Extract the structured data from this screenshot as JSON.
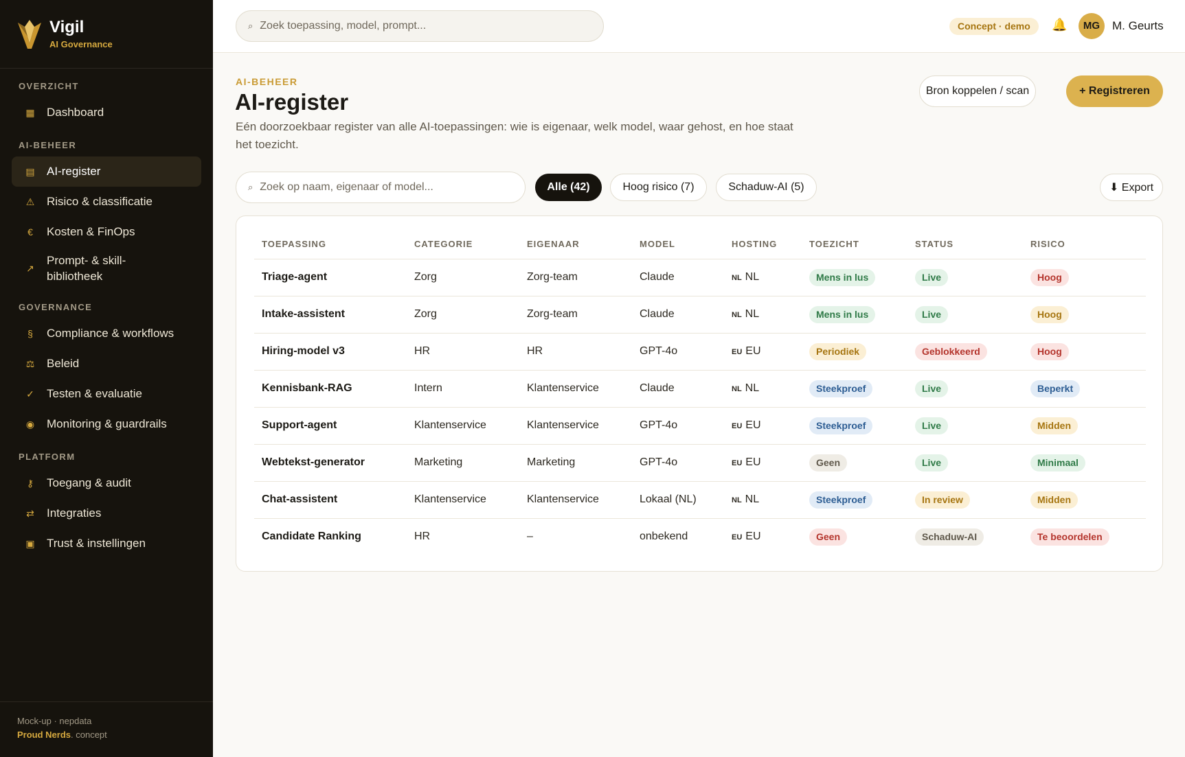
{
  "brand": {
    "name": "Vigil",
    "subtitle": "AI Governance"
  },
  "sidebar": {
    "sections": [
      {
        "label": "OVERZICHT",
        "items": [
          {
            "label": "Dashboard",
            "icon": "dashboard-icon",
            "glyph": "▦"
          }
        ]
      },
      {
        "label": "AI-BEHEER",
        "items": [
          {
            "label": "AI-register",
            "icon": "register-icon",
            "glyph": "▤",
            "active": true
          },
          {
            "label": "Risico & classificatie",
            "icon": "warning-icon",
            "glyph": "⚠"
          },
          {
            "label": "Kosten & FinOps",
            "icon": "euro-icon",
            "glyph": "€"
          },
          {
            "label": "Prompt- & skill-bibliotheek",
            "icon": "trend-icon",
            "glyph": "↗"
          }
        ]
      },
      {
        "label": "GOVERNANCE",
        "items": [
          {
            "label": "Compliance & workflows",
            "icon": "section-icon",
            "glyph": "§"
          },
          {
            "label": "Beleid",
            "icon": "policy-icon",
            "glyph": "⚖"
          },
          {
            "label": "Testen & evaluatie",
            "icon": "check-icon",
            "glyph": "✓"
          },
          {
            "label": "Monitoring & guardrails",
            "icon": "monitor-icon",
            "glyph": "◉"
          }
        ]
      },
      {
        "label": "PLATFORM",
        "items": [
          {
            "label": "Toegang & audit",
            "icon": "key-icon",
            "glyph": "⚷"
          },
          {
            "label": "Integraties",
            "icon": "integration-icon",
            "glyph": "⇄"
          },
          {
            "label": "Trust & instellingen",
            "icon": "settings-icon",
            "glyph": "▣"
          }
        ]
      }
    ],
    "footer": {
      "line1": "Mock-up · nepdata",
      "brand": "Proud Nerds",
      "suffix": ". concept"
    }
  },
  "topbar": {
    "search_placeholder": "Zoek toepassing, model, prompt...",
    "badge": "Concept · demo",
    "bell_icon": "bell-icon",
    "avatar_initials": "MG",
    "user_name": "M. Geurts"
  },
  "page": {
    "eyebrow": "AI-BEHEER",
    "title": "AI-register",
    "description": "Eén doorzoekbaar register van alle AI-toepassingen: wie is eigenaar, welk model, waar gehost, en hoe staat het toezicht.",
    "btn_connect": "Bron koppelen / scan",
    "btn_register": "+ Registreren"
  },
  "filters": {
    "search_placeholder": "Zoek op naam, eigenaar of model...",
    "chips": [
      "Alle (42)",
      "Hoog risico (7)",
      "Schaduw-AI (5)"
    ],
    "active_chip": "Alle (42)",
    "export_label": "⬇ Export"
  },
  "table": {
    "columns": [
      "TOEPASSING",
      "CATEGORIE",
      "EIGENAAR",
      "MODEL",
      "HOSTING",
      "TOEZICHT",
      "STATUS",
      "RISICO"
    ],
    "rows": [
      {
        "name": "Triage-agent",
        "category": "Zorg",
        "owner": "Zorg-team",
        "model": "Claude",
        "host_code": "NL",
        "host": "NL",
        "oversight": "Mens in lus",
        "oversight_tone": "green",
        "status": "Live",
        "status_tone": "green",
        "risk": "Hoog",
        "risk_tone": "red"
      },
      {
        "name": "Intake-assistent",
        "category": "Zorg",
        "owner": "Zorg-team",
        "model": "Claude",
        "host_code": "NL",
        "host": "NL",
        "oversight": "Mens in lus",
        "oversight_tone": "green",
        "status": "Live",
        "status_tone": "green",
        "risk": "Hoog",
        "risk_tone": "amber"
      },
      {
        "name": "Hiring-model v3",
        "category": "HR",
        "owner": "HR",
        "model": "GPT-4o",
        "host_code": "EU",
        "host": "EU",
        "oversight": "Periodiek",
        "oversight_tone": "amber",
        "status": "Geblokkeerd",
        "status_tone": "red",
        "risk": "Hoog",
        "risk_tone": "red"
      },
      {
        "name": "Kennisbank-RAG",
        "category": "Intern",
        "owner": "Klantenservice",
        "model": "Claude",
        "host_code": "NL",
        "host": "NL",
        "oversight": "Steekproef",
        "oversight_tone": "blue",
        "status": "Live",
        "status_tone": "green",
        "risk": "Beperkt",
        "risk_tone": "blue"
      },
      {
        "name": "Support-agent",
        "category": "Klantenservice",
        "owner": "Klantenservice",
        "model": "GPT-4o",
        "host_code": "EU",
        "host": "EU",
        "oversight": "Steekproef",
        "oversight_tone": "blue",
        "status": "Live",
        "status_tone": "green",
        "risk": "Midden",
        "risk_tone": "amber"
      },
      {
        "name": "Webtekst-generator",
        "category": "Marketing",
        "owner": "Marketing",
        "model": "GPT-4o",
        "host_code": "EU",
        "host": "EU",
        "oversight": "Geen",
        "oversight_tone": "grey",
        "status": "Live",
        "status_tone": "green",
        "risk": "Minimaal",
        "risk_tone": "green"
      },
      {
        "name": "Chat-assistent",
        "category": "Klantenservice",
        "owner": "Klantenservice",
        "model": "Lokaal (NL)",
        "host_code": "NL",
        "host": "NL",
        "oversight": "Steekproef",
        "oversight_tone": "blue",
        "status": "In review",
        "status_tone": "amber",
        "risk": "Midden",
        "risk_tone": "amber"
      },
      {
        "name": "Candidate Ranking",
        "category": "HR",
        "owner": "–",
        "model": "onbekend",
        "host_code": "EU",
        "host": "EU",
        "oversight": "Geen",
        "oversight_tone": "red",
        "status": "Schaduw-AI",
        "status_tone": "grey",
        "risk": "Te beoordelen",
        "risk_tone": "red"
      }
    ]
  }
}
